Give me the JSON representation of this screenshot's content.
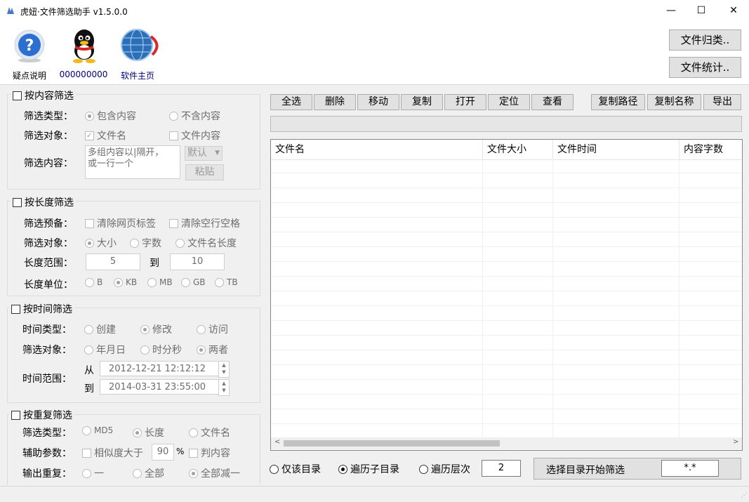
{
  "window": {
    "title": "虎妞·文件筛选助手 v1.5.0.0",
    "min": "—",
    "max": "☐",
    "close": "✕"
  },
  "tools": {
    "help": "疑点说明",
    "qq": "000000000",
    "home": "软件主页"
  },
  "right_buttons": {
    "classify": "文件归类..",
    "stats": "文件统计.."
  },
  "content_filter": {
    "title": "按内容筛选",
    "type_label": "筛选类型：",
    "type_opt1": "包含内容",
    "type_opt2": "不含内容",
    "target_label": "筛选对象：",
    "target_opt1": "文件名",
    "target_opt2": "文件内容",
    "content_label": "筛选内容：",
    "content_placeholder": "多组内容以|隔开，\n或一行一个",
    "default_select": "默认",
    "paste": "粘贴"
  },
  "length_filter": {
    "title": "按长度筛选",
    "prep_label": "筛选预备：",
    "prep_opt1": "清除网页标签",
    "prep_opt2": "清除空行空格",
    "target_label": "筛选对象：",
    "target_opt1": "大小",
    "target_opt2": "字数",
    "target_opt3": "文件名长度",
    "range_label": "长度范围：",
    "range_from": "5",
    "range_to_label": "到",
    "range_to": "10",
    "unit_label": "长度单位：",
    "unit_b": "B",
    "unit_kb": "KB",
    "unit_mb": "MB",
    "unit_gb": "GB",
    "unit_tb": "TB"
  },
  "time_filter": {
    "title": "按时间筛选",
    "type_label": "时间类型：",
    "type_opt1": "创建",
    "type_opt2": "修改",
    "type_opt3": "访问",
    "target_label": "筛选对象：",
    "target_opt1": "年月日",
    "target_opt2": "时分秒",
    "target_opt3": "两者",
    "range_label": "时间范围：",
    "from_label": "从",
    "from_value": "2012-12-21 12:12:12",
    "to_label": "到",
    "to_value": "2014-03-31 23:55:00"
  },
  "dup_filter": {
    "title": "按重复筛选",
    "type_label": "筛选类型：",
    "type_opt1": "MD5",
    "type_opt2": "长度",
    "type_opt3": "文件名",
    "aux_label": "辅助参数：",
    "aux_opt1": "相似度大于",
    "aux_value": "90",
    "aux_unit": "%",
    "aux_opt2": "判内容",
    "out_label": "输出重复：",
    "out_opt1": "一",
    "out_opt2": "全部",
    "out_opt3": "全部减一"
  },
  "toolbar": {
    "select_all": "全选",
    "delete": "删除",
    "move": "移动",
    "copy": "复制",
    "open": "打开",
    "locate": "定位",
    "view": "查看",
    "copy_path": "复制路径",
    "copy_name": "复制名称",
    "export": "导出"
  },
  "list": {
    "col_name": "文件名",
    "col_size": "文件大小",
    "col_time": "文件时间",
    "col_words": "内容字数"
  },
  "bottom": {
    "opt_dir": "仅该目录",
    "opt_sub": "遍历子目录",
    "opt_level": "遍历层次",
    "level_value": "2",
    "start_button": "选择目录开始筛选",
    "pattern": "*.*"
  }
}
